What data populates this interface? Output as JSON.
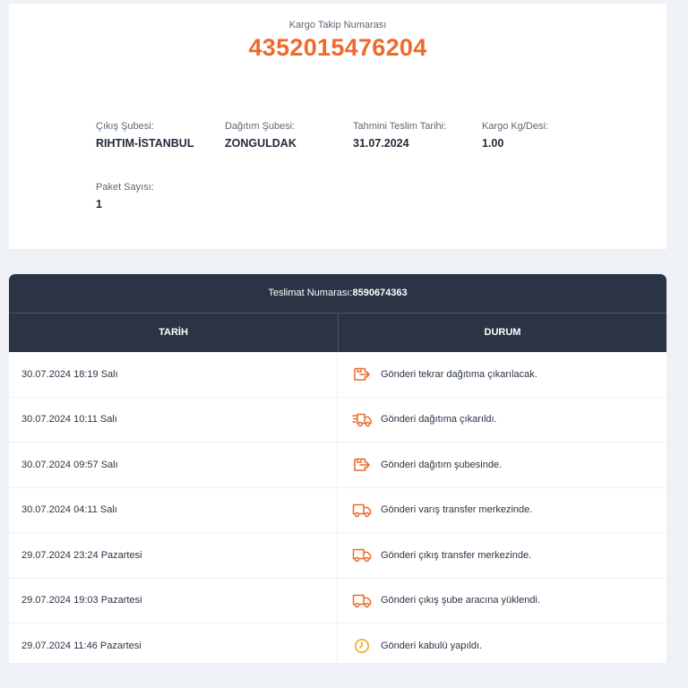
{
  "tracking": {
    "label": "Kargo Takip Numarası",
    "number": "4352015476204"
  },
  "info": [
    {
      "label": "Çıkış Şubesi:",
      "value": "RIHTIM-İSTANBUL"
    },
    {
      "label": "Dağıtım Şubesi:",
      "value": "ZONGULDAK"
    },
    {
      "label": "Tahmini Teslim Tarihi:",
      "value": "31.07.2024"
    },
    {
      "label": "Kargo Kg/Desi:",
      "value": "1.00"
    },
    {
      "label": "Paket Sayısı:",
      "value": "1"
    }
  ],
  "table": {
    "title_label": "Teslimat Numarası:",
    "title_number": "8590674363",
    "headers": {
      "date": "TARİH",
      "status": "DURUM"
    },
    "rows": [
      {
        "date": "30.07.2024 18:19 Salı",
        "status": "Gönderi tekrar dağıtıma çıkarılacak.",
        "icon": "box-arrow-icon"
      },
      {
        "date": "30.07.2024 10:11 Salı",
        "status": "Gönderi dağıtıma çıkarıldı.",
        "icon": "fast-truck-icon"
      },
      {
        "date": "30.07.2024 09:57 Salı",
        "status": "Gönderi dağıtım şubesinde.",
        "icon": "box-arrow-icon"
      },
      {
        "date": "30.07.2024 04:11 Salı",
        "status": "Gönderi varış transfer merkezinde.",
        "icon": "truck-icon"
      },
      {
        "date": "29.07.2024 23:24 Pazartesi",
        "status": "Gönderi çıkış transfer merkezinde.",
        "icon": "truck-icon"
      },
      {
        "date": "29.07.2024 19:03 Pazartesi",
        "status": "Gönderi çıkış şube aracına yüklendi.",
        "icon": "truck-icon"
      },
      {
        "date": "29.07.2024 11:46 Pazartesi",
        "status": "Gönderi kabulü yapıldı.",
        "icon": "clock-icon"
      }
    ]
  },
  "colors": {
    "accent": "#ee6a2c",
    "header_bg": "#2a3445",
    "clock": "#f2a81d"
  }
}
